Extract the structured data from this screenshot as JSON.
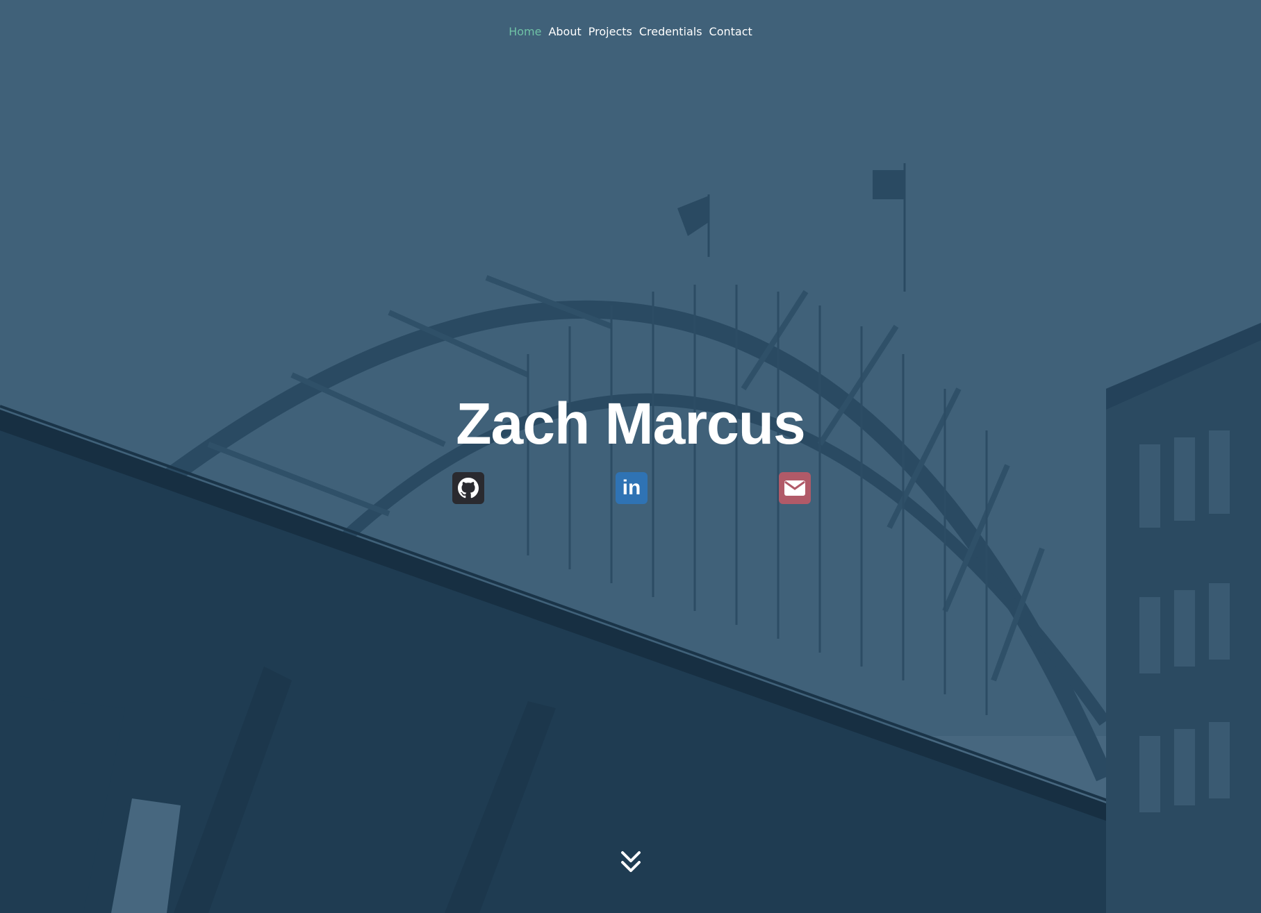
{
  "site": {
    "name": "Zach Marcus",
    "accent_color": "#6fc2a6",
    "overlay_color": "#3f6078"
  },
  "nav": {
    "items": [
      {
        "label": "Home",
        "active": true
      },
      {
        "label": "About",
        "active": false
      },
      {
        "label": "Projects",
        "active": false
      },
      {
        "label": "Credentials",
        "active": false
      },
      {
        "label": "Contact",
        "active": false
      }
    ]
  },
  "hero": {
    "title": "Zach Marcus",
    "background": "bridge-arch-photo",
    "social": [
      {
        "name": "github",
        "icon": "github-icon",
        "color": "#2a2a2f"
      },
      {
        "name": "linkedin",
        "icon": "linkedin-icon",
        "label": "in",
        "color": "#2f73b4"
      },
      {
        "name": "email",
        "icon": "envelope-icon",
        "color": "#b15a68"
      }
    ],
    "scroll_icon": "double-chevron-down-icon"
  }
}
